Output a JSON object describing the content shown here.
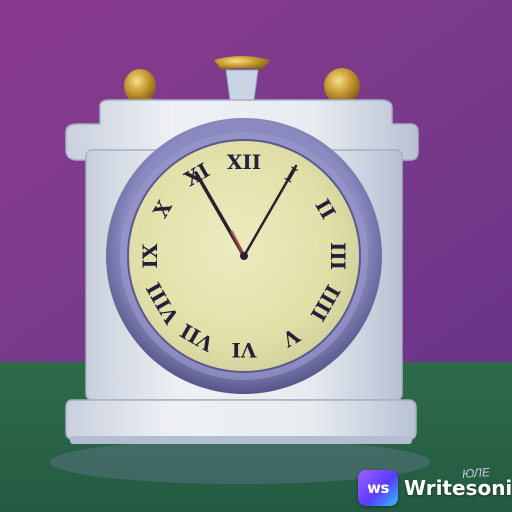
{
  "scene": {
    "subject": "mantel-clock",
    "colors": {
      "wall": "#7a3a8a",
      "floor": "#2f6b4a",
      "clock_body": "#e4e8ec",
      "bezel": "#6f6fa6",
      "dial": "#e8e6b0",
      "finials": "#c8a030"
    },
    "clock": {
      "numerals": [
        "XII",
        "I",
        "II",
        "III",
        "IIII",
        "V",
        "VI",
        "VII",
        "VIII",
        "IX",
        "X",
        "XI"
      ],
      "time": {
        "hour": 12,
        "minute": 5
      }
    }
  },
  "signature": "ЮЛЕ",
  "watermark": {
    "logo_text": "ws",
    "brand_name": "Writesonic"
  }
}
